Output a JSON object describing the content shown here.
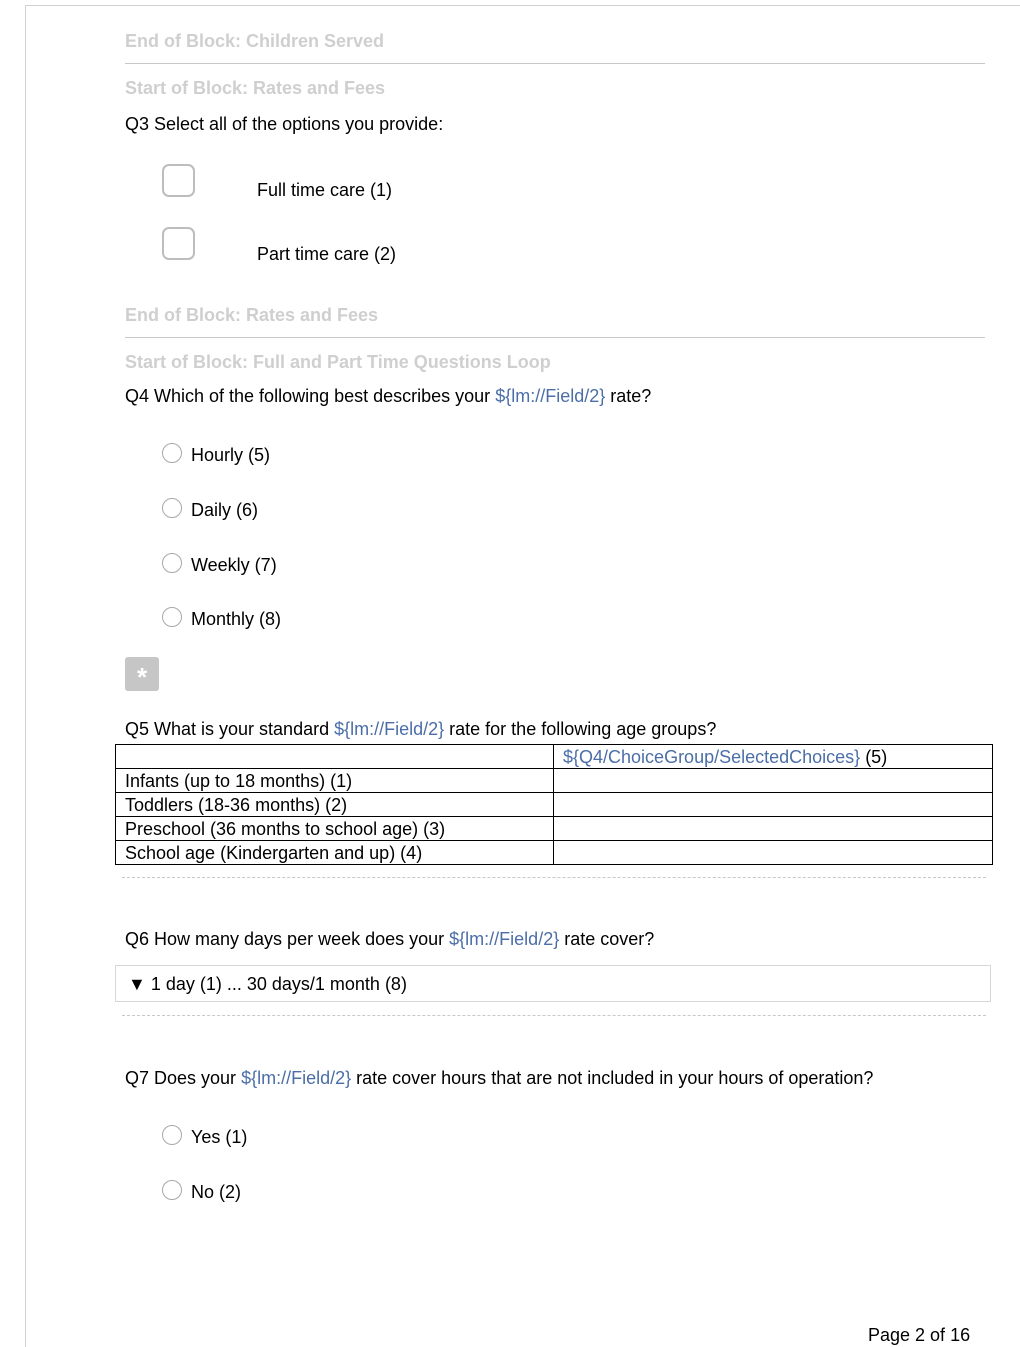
{
  "blocks": {
    "end_children_served": "End of Block: Children Served",
    "start_rates_fees": "Start of Block: Rates and Fees",
    "end_rates_fees": "End of Block: Rates and Fees",
    "start_loop": "Start of Block: Full and Part Time Questions Loop"
  },
  "q3": {
    "text": "Q3 Select all of the options you provide:",
    "options": [
      "Full time care  (1)",
      "Part time care  (2)"
    ]
  },
  "q4": {
    "prefix": "Q4 Which of the following best describes your ",
    "pipe": "${lm://Field/2}",
    "suffix": " rate?",
    "options": [
      "Hourly  (5)",
      "Daily  (6)",
      "Weekly  (7)",
      "Monthly  (8)"
    ]
  },
  "asterisk": "*",
  "q5": {
    "prefix": "Q5 What is your standard ",
    "pipe": "${lm://Field/2}",
    "suffix": " rate for the following age groups?",
    "column_header_pipe": "${Q4/ChoiceGroup/SelectedChoices}",
    "column_header_suffix": " (5)",
    "rows": [
      "Infants (up to 18 months) (1)",
      "Toddlers (18-36 months) (2)",
      "Preschool (36 months to school age) (3)",
      "School age (Kindergarten and up) (4)"
    ]
  },
  "q6": {
    "prefix": "Q6 How many days per week does your ",
    "pipe": "${lm://Field/2}",
    "suffix": " rate cover?",
    "dropdown": "▼ 1 day (1) ... 30 days/1 month (8)"
  },
  "q7": {
    "prefix": "Q7 Does your ",
    "pipe": "${lm://Field/2}",
    "suffix": " rate cover hours that are not included in your hours of operation?",
    "options": [
      "Yes  (1)",
      "No  (2)"
    ]
  },
  "footer": {
    "page": "Page 2 of 16"
  },
  "colors": {
    "pipe_text": "#4b6ea8",
    "block_label": "#cfcfcf"
  }
}
